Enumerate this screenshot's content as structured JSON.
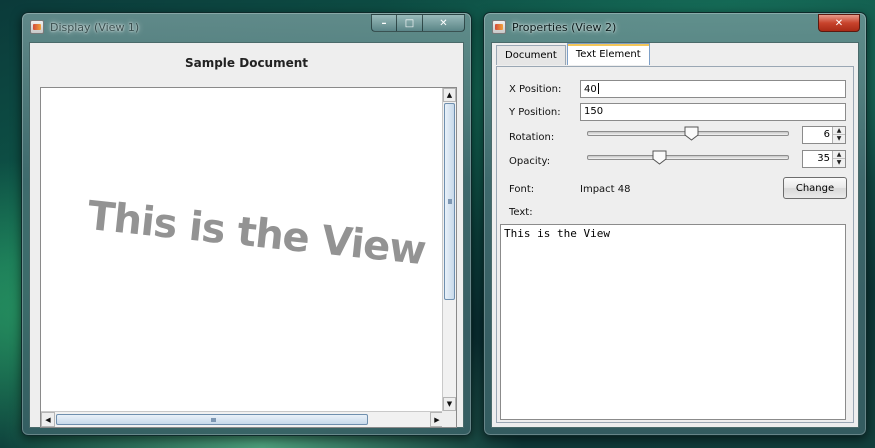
{
  "display_window": {
    "title": "Display (View 1)",
    "document_title": "Sample Document",
    "rendered_text": "This is the View"
  },
  "properties_window": {
    "title": "Properties (View 2)",
    "tabs": [
      {
        "label": "Document",
        "active": false
      },
      {
        "label": "Text Element",
        "active": true
      }
    ],
    "fields": {
      "x_position": {
        "label": "X Position:",
        "value": "40"
      },
      "y_position": {
        "label": "Y Position:",
        "value": "150"
      },
      "rotation": {
        "label": "Rotation:",
        "value": "6",
        "slider_fraction": 0.52
      },
      "opacity": {
        "label": "Opacity:",
        "value": "35",
        "slider_fraction": 0.35
      },
      "font": {
        "label": "Font:",
        "value": "Impact 48",
        "button_label": "Change"
      },
      "text": {
        "label": "Text:",
        "value": "This is the View"
      }
    }
  },
  "icons": {
    "window_icon": "java-app-icon",
    "caption": [
      "minimize-icon",
      "maximize-icon",
      "close-icon"
    ]
  },
  "colors": {
    "close_button": "#c8432c",
    "rendered_text": "#939393",
    "scroll_thumb": "#c7d9ea"
  }
}
